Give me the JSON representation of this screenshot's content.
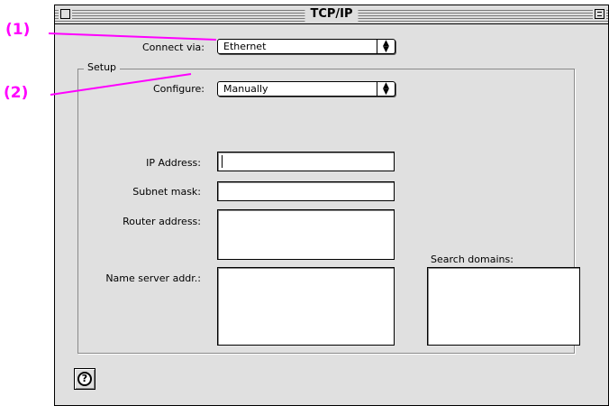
{
  "window": {
    "title": "TCP/IP"
  },
  "callouts": {
    "one": "(1)",
    "two": "(2)"
  },
  "connect": {
    "label": "Connect via:",
    "value": "Ethernet"
  },
  "setup": {
    "group_title": "Setup",
    "configure_label": "Configure:",
    "configure_value": "Manually",
    "ip_label": "IP Address:",
    "ip_value": "",
    "subnet_label": "Subnet mask:",
    "subnet_value": "",
    "router_label": "Router address:",
    "router_value": "",
    "nameserver_label": "Name server addr.:",
    "nameserver_value": "",
    "search_label": "Search domains:",
    "search_value": ""
  },
  "help": {
    "label": "?"
  },
  "colors": {
    "callout": "#ff00ff",
    "window_bg": "#e0e0e0"
  },
  "icons": {
    "popup_arrows": "up-down-arrows-icon",
    "help": "help-icon"
  }
}
